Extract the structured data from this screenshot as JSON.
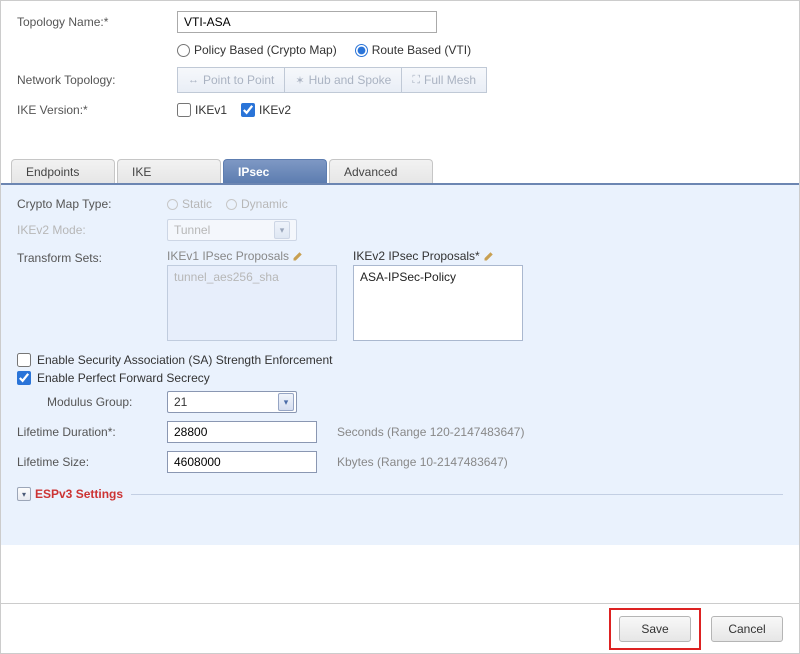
{
  "header": {
    "topology_name_label": "Topology Name:*",
    "topology_name_value": "VTI-ASA",
    "policy_based_label": "Policy Based (Crypto Map)",
    "route_based_label": "Route Based (VTI)",
    "network_topology_label": "Network Topology:",
    "topo_ptp": "Point to Point",
    "topo_hub": "Hub and Spoke",
    "topo_mesh": "Full Mesh",
    "ike_version_label": "IKE Version:*",
    "ikev1_label": "IKEv1",
    "ikev2_label": "IKEv2"
  },
  "tabs": {
    "endpoints": "Endpoints",
    "ike": "IKE",
    "ipsec": "IPsec",
    "advanced": "Advanced"
  },
  "ipsec": {
    "crypto_map_type_label": "Crypto Map Type:",
    "static_label": "Static",
    "dynamic_label": "Dynamic",
    "ikev2_mode_label": "IKEv2 Mode:",
    "ikev2_mode_value": "Tunnel",
    "transform_sets_label": "Transform Sets:",
    "ikev1_proposals_label": "IKEv1 IPsec Proposals",
    "ikev1_proposals_item": "tunnel_aes256_sha",
    "ikev2_proposals_label": "IKEv2 IPsec Proposals*",
    "ikev2_proposals_item": "ASA-IPSec-Policy",
    "sa_strength_label": "Enable Security Association (SA) Strength Enforcement",
    "pfs_label": "Enable Perfect Forward Secrecy",
    "modulus_group_label": "Modulus Group:",
    "modulus_group_value": "21",
    "lifetime_duration_label": "Lifetime Duration*:",
    "lifetime_duration_value": "28800",
    "lifetime_duration_hint": "Seconds (Range 120-2147483647)",
    "lifetime_size_label": "Lifetime Size:",
    "lifetime_size_value": "4608000",
    "lifetime_size_hint": "Kbytes (Range 10-2147483647)",
    "espv3_title": "ESPv3 Settings"
  },
  "footer": {
    "save": "Save",
    "cancel": "Cancel"
  }
}
